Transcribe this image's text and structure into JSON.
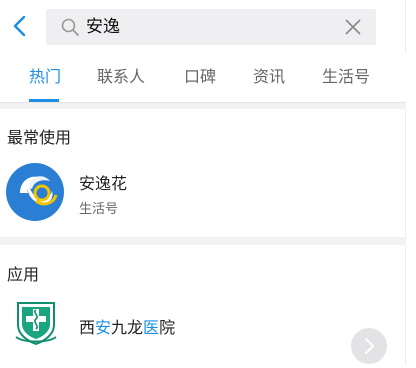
{
  "search": {
    "query": "安逸"
  },
  "tabs": [
    {
      "label": "热门",
      "active": true
    },
    {
      "label": "联系人",
      "active": false
    },
    {
      "label": "口碑",
      "active": false
    },
    {
      "label": "资讯",
      "active": false
    },
    {
      "label": "生活号",
      "active": false
    }
  ],
  "sections": {
    "frequent": {
      "title": "最常使用",
      "item": {
        "name": "安逸花",
        "subtitle": "生活号",
        "icon": "anyihua-logo"
      }
    },
    "apps": {
      "title": "应用",
      "item": {
        "name_parts": [
          "西",
          "安",
          "九龙",
          "医",
          "院"
        ],
        "highlighted_parts": [
          "安",
          "医"
        ],
        "icon": "hospital-shield-logo"
      }
    }
  },
  "colors": {
    "accent": "#1a8fe3",
    "search_bg": "#efeff1",
    "divider": "#f2f2f4"
  }
}
